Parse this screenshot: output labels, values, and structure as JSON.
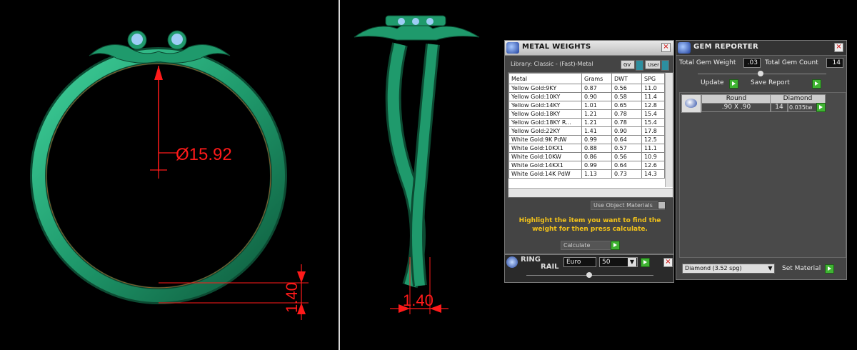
{
  "left_view": {
    "diameter_label": "Ø15.92",
    "thickness_label": "1.40"
  },
  "side_view": {
    "width_label": "1.40"
  },
  "metal_weights": {
    "title": "METAL WEIGHTS",
    "library": "Library: Classic - (Fast)-Metal",
    "gv_label": "GV",
    "user_label": "User",
    "columns": [
      "Metal",
      "Grams",
      "DWT",
      "SPG"
    ],
    "rows": [
      [
        "Yellow Gold:9KY",
        "0.87",
        "0.56",
        "11.0"
      ],
      [
        "Yellow Gold:10KY",
        "0.90",
        "0.58",
        "11.4"
      ],
      [
        "Yellow Gold:14KY",
        "1.01",
        "0.65",
        "12.8"
      ],
      [
        "Yellow Gold:18KY",
        "1.21",
        "0.78",
        "15.4"
      ],
      [
        "Yellow Gold:18KY R...",
        "1.21",
        "0.78",
        "15.4"
      ],
      [
        "Yellow Gold:22KY",
        "1.41",
        "0.90",
        "17.8"
      ],
      [
        "White Gold:9K PdW",
        "0.99",
        "0.64",
        "12.5"
      ],
      [
        "White Gold:10KX1",
        "0.88",
        "0.57",
        "11.1"
      ],
      [
        "White Gold:10KW",
        "0.86",
        "0.56",
        "10.9"
      ],
      [
        "White Gold:14KX1",
        "0.99",
        "0.64",
        "12.6"
      ],
      [
        "White Gold:14K PdW",
        "1.13",
        "0.73",
        "14.3"
      ]
    ],
    "use_object_materials": "Use Object Materials",
    "instruction": "Highlight the item you want to find the weight for then press calculate.",
    "calculate": "Calculate"
  },
  "ring_rail": {
    "label_1": "RING",
    "label_2": "RAIL",
    "unit": "Euro",
    "size": "50"
  },
  "gem_reporter": {
    "title": "GEM REPORTER",
    "total_weight_label": "Total Gem Weight",
    "total_weight": ".03",
    "total_count_label": "Total Gem Count",
    "total_count": "14",
    "update": "Update",
    "save_report": "Save Report",
    "gem": {
      "shape": "Round",
      "material": "Diamond",
      "size": ".90 X .90",
      "count": "14",
      "weight": "0.035tw"
    },
    "material_select": "Diamond      (3.52 spg)",
    "set_material": "Set Material"
  },
  "colors": {
    "ring_green": "#1f9a6c",
    "dimension_red": "#ff1a1a",
    "panel_grey": "#444444",
    "gem_blue": "#9ecdf5"
  }
}
